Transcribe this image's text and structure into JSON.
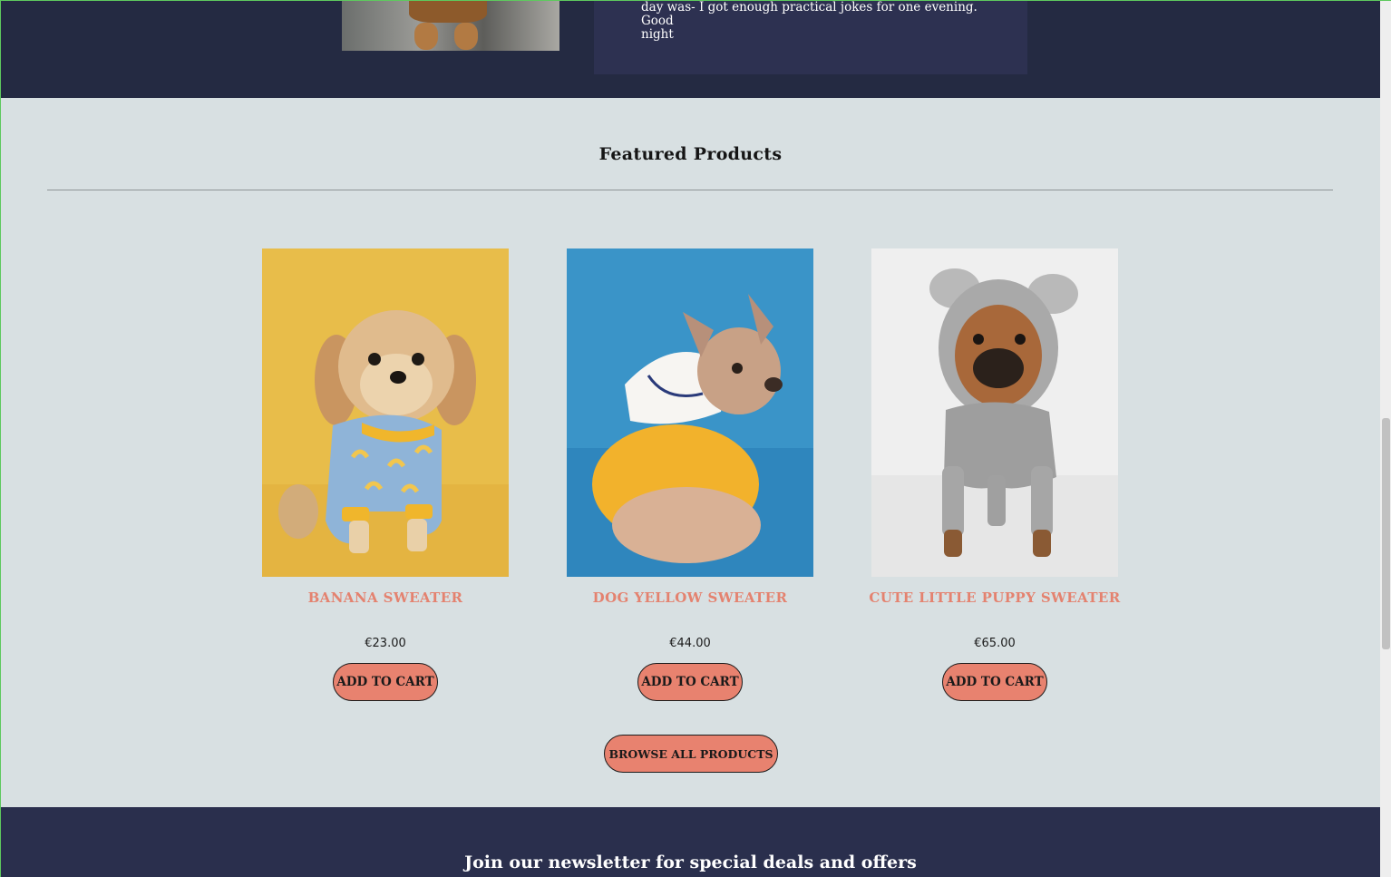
{
  "testimonial": {
    "text_line1": "day was- I got enough practical jokes for one evening. Good",
    "text_line2": "night"
  },
  "featured": {
    "title": "Featured Products",
    "products": [
      {
        "name": "BANANA SWEATER",
        "price": "€23.00",
        "button": "ADD TO CART"
      },
      {
        "name": "DOG YELLOW SWEATER",
        "price": "€44.00",
        "button": "ADD TO CART"
      },
      {
        "name": "CUTE LITTLE PUPPY SWEATER",
        "price": "€65.00",
        "button": "ADD TO CART"
      }
    ],
    "browse_label": "BROWSE ALL PRODUCTS"
  },
  "newsletter": {
    "title": "Join our newsletter for special deals and offers"
  },
  "colors": {
    "dark_band": "#242a42",
    "card_bg": "#2d3151",
    "section_bg": "#d8e0e2",
    "accent": "#e8826f",
    "product_name": "#e4826f"
  }
}
